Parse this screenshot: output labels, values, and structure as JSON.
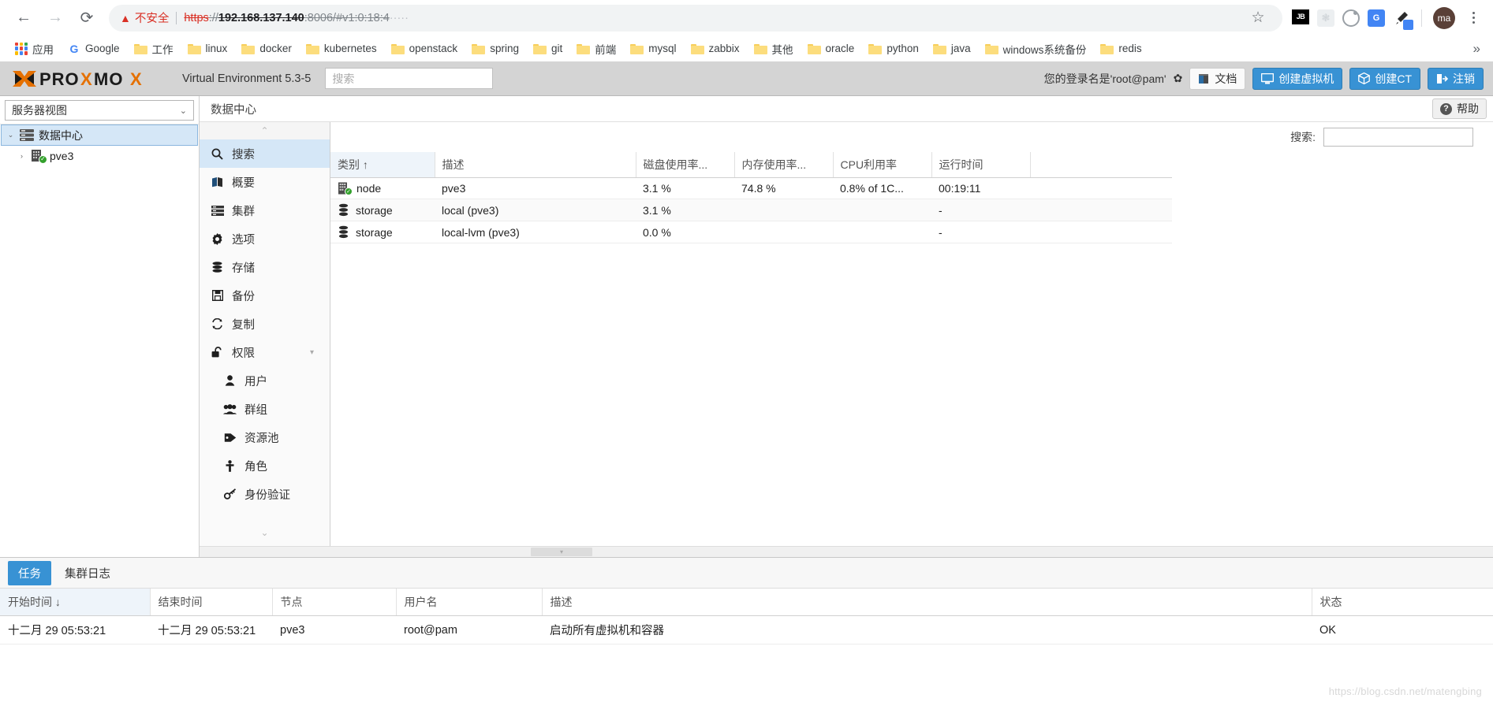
{
  "browser": {
    "nav": {
      "back": "←",
      "forward": "→",
      "reload": "⟳"
    },
    "security_warning": "不安全",
    "url": {
      "scheme": "https",
      "separator": "://",
      "host": "192.168.137.140",
      "port_path": ":8006/#v1:0:18:4",
      "truncated": "·····"
    },
    "star_icon": "☆",
    "profile_initials": "ma",
    "extensions": [
      "jetbrains-icon",
      "puzzle-icon",
      "orbit-icon",
      "google-translate-icon",
      "colorpicker-icon"
    ],
    "bookmarks": [
      {
        "label": "应用",
        "icon": "apps-grid-icon"
      },
      {
        "label": "Google",
        "icon": "google-icon"
      },
      {
        "label": "工作",
        "icon": "folder-icon"
      },
      {
        "label": "linux",
        "icon": "folder-icon"
      },
      {
        "label": "docker",
        "icon": "folder-icon"
      },
      {
        "label": "kubernetes",
        "icon": "folder-icon"
      },
      {
        "label": "openstack",
        "icon": "folder-icon"
      },
      {
        "label": "spring",
        "icon": "folder-icon"
      },
      {
        "label": "git",
        "icon": "folder-icon"
      },
      {
        "label": "前端",
        "icon": "folder-icon"
      },
      {
        "label": "mysql",
        "icon": "folder-icon"
      },
      {
        "label": "zabbix",
        "icon": "folder-icon"
      },
      {
        "label": "其他",
        "icon": "folder-icon"
      },
      {
        "label": "oracle",
        "icon": "folder-icon"
      },
      {
        "label": "python",
        "icon": "folder-icon"
      },
      {
        "label": "java",
        "icon": "folder-icon"
      },
      {
        "label": "windows系统备份",
        "icon": "folder-icon"
      },
      {
        "label": "redis",
        "icon": "folder-icon"
      }
    ],
    "bookmarks_overflow": "»"
  },
  "app": {
    "product": "PROXMOX",
    "version_text": "Virtual Environment 5.3-5",
    "search_placeholder": "搜索",
    "login_text": "您的登录名是'root@pam'",
    "buttons": {
      "docs": "文档",
      "create_vm": "创建虚拟机",
      "create_ct": "创建CT",
      "logout": "注销"
    }
  },
  "sidebar": {
    "view_selector": "服务器视图",
    "tree": [
      {
        "label": "数据中心",
        "icon": "datacenter-icon",
        "selected": true
      },
      {
        "label": "pve3",
        "icon": "node-icon",
        "selected": false
      }
    ]
  },
  "breadcrumb": "数据中心",
  "help_button": "帮助",
  "navmenu": [
    {
      "label": "搜索",
      "icon": "search-icon",
      "active": true,
      "sub": false
    },
    {
      "label": "概要",
      "icon": "book-icon",
      "active": false,
      "sub": false
    },
    {
      "label": "集群",
      "icon": "server-icon",
      "active": false,
      "sub": false
    },
    {
      "label": "选项",
      "icon": "gear-icon",
      "active": false,
      "sub": false
    },
    {
      "label": "存储",
      "icon": "database-icon",
      "active": false,
      "sub": false
    },
    {
      "label": "备份",
      "icon": "save-icon",
      "active": false,
      "sub": false
    },
    {
      "label": "复制",
      "icon": "replicate-icon",
      "active": false,
      "sub": false
    },
    {
      "label": "权限",
      "icon": "unlock-icon",
      "active": false,
      "sub": false,
      "caret": "▾"
    },
    {
      "label": "用户",
      "icon": "user-icon",
      "active": false,
      "sub": true
    },
    {
      "label": "群组",
      "icon": "group-icon",
      "active": false,
      "sub": true
    },
    {
      "label": "资源池",
      "icon": "tag-icon",
      "active": false,
      "sub": true
    },
    {
      "label": "角色",
      "icon": "role-icon",
      "active": false,
      "sub": true
    },
    {
      "label": "身份验证",
      "icon": "key-icon",
      "active": false,
      "sub": true
    }
  ],
  "content": {
    "search_label": "搜索:",
    "search_value": "",
    "columns": [
      "类别 ↑",
      "描述",
      "磁盘使用率...",
      "内存使用率...",
      "CPU利用率",
      "运行时间"
    ],
    "rows": [
      {
        "icon": "node-icon",
        "type": "node",
        "description": "pve3",
        "disk": "3.1 %",
        "mem": "74.8 %",
        "cpu": "0.8% of 1C...",
        "uptime": "00:19:11"
      },
      {
        "icon": "storage-icon",
        "type": "storage",
        "description": "local (pve3)",
        "disk": "3.1 %",
        "mem": "",
        "cpu": "",
        "uptime": "-"
      },
      {
        "icon": "storage-icon",
        "type": "storage",
        "description": "local-lvm (pve3)",
        "disk": "0.0 %",
        "mem": "",
        "cpu": "",
        "uptime": "-"
      }
    ]
  },
  "tasks": {
    "tabs": [
      {
        "label": "任务",
        "active": true
      },
      {
        "label": "集群日志",
        "active": false
      }
    ],
    "columns": [
      "开始时间 ↓",
      "结束时间",
      "节点",
      "用户名",
      "描述",
      "状态"
    ],
    "rows": [
      {
        "start": "十二月 29 05:53:21",
        "end": "十二月 29 05:53:21",
        "node": "pve3",
        "user": "root@pam",
        "description": "启动所有虚拟机和容器",
        "status": "OK"
      }
    ]
  },
  "watermark": "https://blog.csdn.net/matengbing"
}
